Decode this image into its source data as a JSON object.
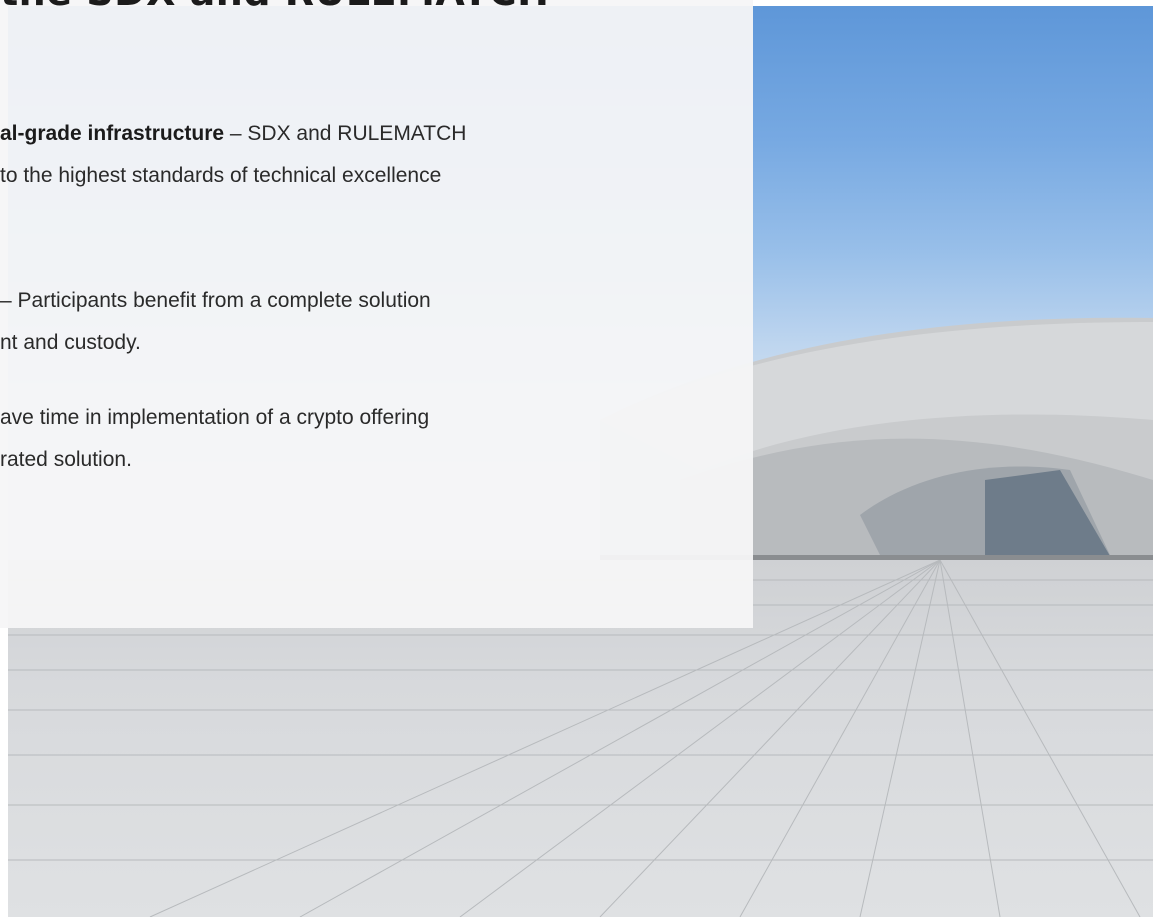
{
  "headline": "the SDX and RULEMATCH",
  "paragraphs": [
    {
      "lines": [
        {
          "bold": "al-grade infrastructure",
          "rest": " – SDX and RULEMATCH"
        },
        {
          "bold": "",
          "rest": "to the highest standards of technical excellence"
        }
      ]
    },
    {
      "lines": [
        {
          "bold": "",
          "rest": "– Participants benefit from a complete solution"
        },
        {
          "bold": "",
          "rest": "nt and custody."
        }
      ]
    },
    {
      "lines": [
        {
          "bold": "",
          "rest": "ave time in implementation of a crypto offering"
        },
        {
          "bold": "",
          "rest": "rated solution."
        }
      ]
    }
  ]
}
